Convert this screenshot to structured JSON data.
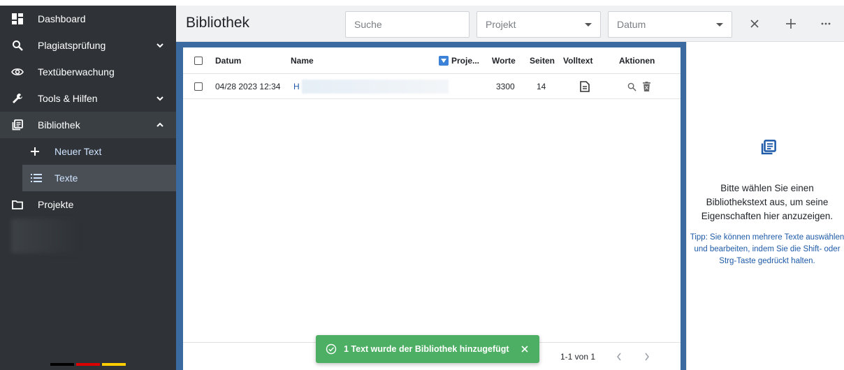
{
  "sidebar": {
    "items": [
      {
        "label": "Dashboard"
      },
      {
        "label": "Plagiatsprüfung"
      },
      {
        "label": "Textüberwachung"
      },
      {
        "label": "Tools & Hilfen"
      },
      {
        "label": "Bibliothek"
      }
    ],
    "sub": [
      {
        "label": "Neuer Text"
      },
      {
        "label": "Texte"
      }
    ],
    "projects": {
      "label": "Projekte"
    },
    "flag_colors": [
      "#000000",
      "#dd0000",
      "#ffce00"
    ]
  },
  "toolbar": {
    "title": "Bibliothek",
    "search_placeholder": "Suche",
    "project_value": "Projekt",
    "date_value": "Datum"
  },
  "table": {
    "headers": {
      "date": "Datum",
      "name": "Name",
      "project": "Proje...",
      "words": "Worte",
      "pages": "Seiten",
      "fulltext": "Volltext",
      "actions": "Aktionen"
    },
    "rows": [
      {
        "date": "04/28 2023 12:34",
        "name": "H",
        "words": "3300",
        "pages": "14"
      }
    ],
    "pager": "1-1 von 1"
  },
  "details": {
    "message": "Bitte wählen Sie einen Bibliothekstext aus, um seine Eigenschaften hier anzuzeigen.",
    "tip": "Tipp: Sie können mehrere Texte auswählen und bearbeiten, indem Sie die Shift- oder Strg-Taste gedrückt halten."
  },
  "toast": {
    "message": "1 Text wurde der Bibliothek hinzugefügt"
  },
  "colors": {
    "sidebar_bg": "#2f3337",
    "accent_blue": "#3b82d8",
    "toast_green": "#4caf63",
    "tip_blue": "#1e5aa8"
  }
}
